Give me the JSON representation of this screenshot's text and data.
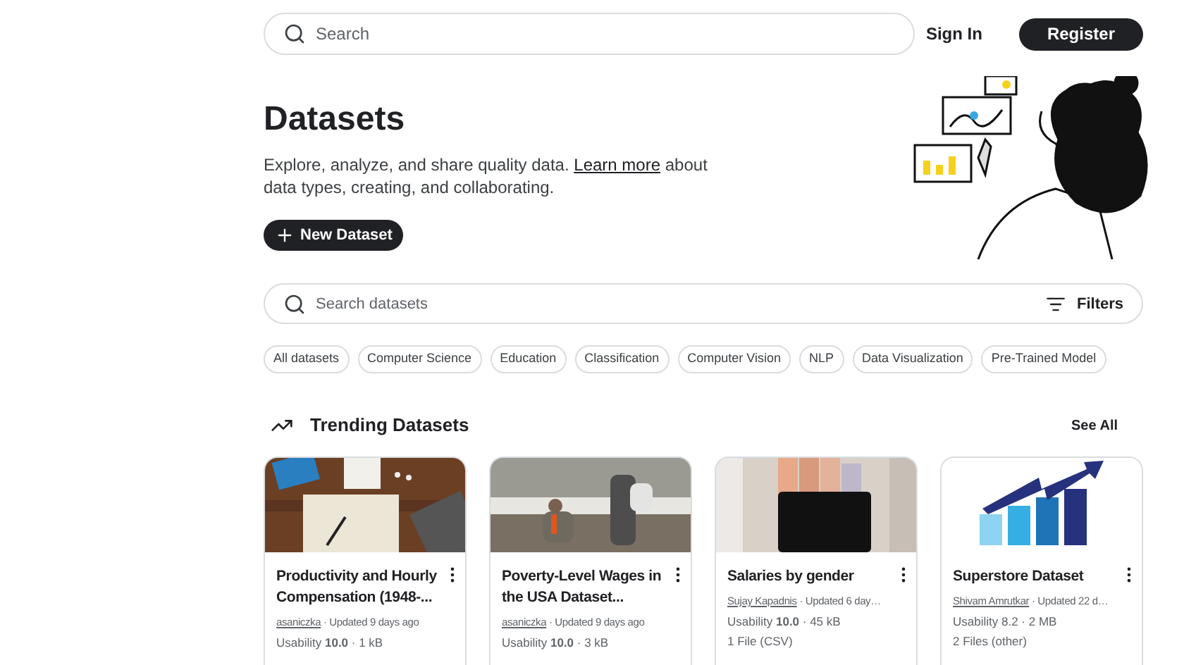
{
  "top_search": {
    "placeholder": "Search"
  },
  "auth": {
    "sign_in": "Sign In",
    "register": "Register"
  },
  "header": {
    "title": "Datasets",
    "description_before": "Explore, analyze, and share quality data.",
    "link": "Learn more",
    "description_after": "about data types, creating, and collaborating.",
    "new_button": "New Dataset"
  },
  "dataset_search": {
    "placeholder": "Search datasets",
    "filters": "Filters"
  },
  "chips": [
    {
      "label": "All datasets"
    },
    {
      "label": "Computer Science"
    },
    {
      "label": "Education"
    },
    {
      "label": "Classification"
    },
    {
      "label": "Computer Vision"
    },
    {
      "label": "NLP"
    },
    {
      "label": "Data Visualization"
    },
    {
      "label": "Pre-Trained Model"
    }
  ],
  "section": {
    "title": "Trending Datasets",
    "see_all": "See All"
  },
  "cards": [
    {
      "title": "Productivity and Hourly Compensation (1948-...",
      "owner": "asaniczka",
      "updated": "· Updated 9 days ago",
      "usability": "Usability **10.0** · 1 kB"
    },
    {
      "title": "Poverty-Level Wages in the USA Dataset...",
      "owner": "asaniczka",
      "updated": "· Updated 9 days ago",
      "usability": "Usability **10.0** · 3 kB"
    },
    {
      "title": "Salaries by gender",
      "owner": "Sujay Kapadnis",
      "updated": "· Updated 6 day…",
      "usability": "Usability **10.0** · 45 kB",
      "files": "1 File (CSV)"
    },
    {
      "title": "Superstore Dataset",
      "owner": "Shivam Amrutkar",
      "updated": "· Updated 22 d…",
      "usability": "Usability 8.2 · 2 MB",
      "files": "2 Files (other)"
    }
  ]
}
